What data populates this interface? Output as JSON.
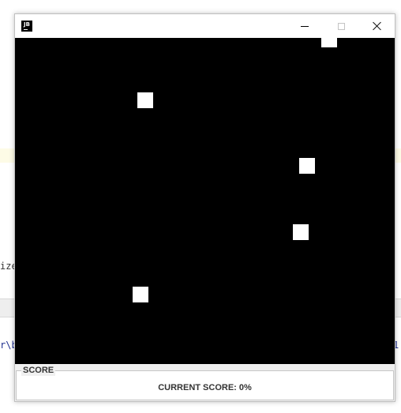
{
  "background_ide": {
    "fragment_left_1": "ize",
    "fragment_left_2": "r\\b",
    "fragment_right": "1"
  },
  "window": {
    "icon_text": "JB",
    "title": "",
    "controls": {
      "minimize": "minimize-icon",
      "maximize": "maximize-icon",
      "close": "close-icon"
    }
  },
  "game": {
    "background_color": "#000000",
    "block_color": "#ffffff",
    "block_count": 5
  },
  "score_panel": {
    "legend": "SCORE",
    "current_score_text": "CURRENT SCORE: 0%"
  },
  "colors": {
    "window_bg": "#f0f0f0",
    "titlebar_bg": "#ffffff",
    "canvas_bg": "#000000",
    "block": "#ffffff"
  }
}
